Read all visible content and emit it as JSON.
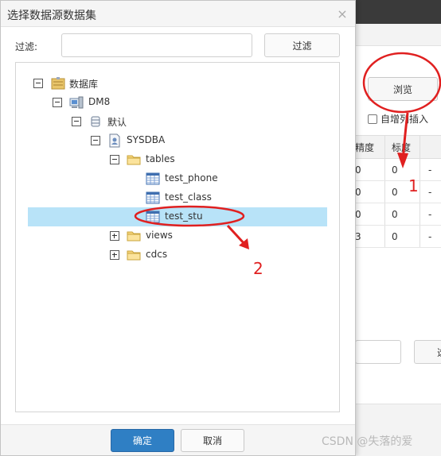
{
  "colors": {
    "accent": "#2f7fc4",
    "selection": "#b8e3f8",
    "annotation": "#e02020"
  },
  "dialog": {
    "title": "选择数据源数据集",
    "close_icon": "×"
  },
  "filter": {
    "label": "过滤:",
    "value": "",
    "placeholder": "",
    "button_label": "过滤"
  },
  "tree": {
    "nodes": [
      {
        "label": "数据库",
        "icon": "database-icon",
        "toggle": "minus"
      },
      {
        "label": "DM8",
        "icon": "server-icon",
        "toggle": "minus"
      },
      {
        "label": "默认",
        "icon": "cylinder-icon",
        "toggle": "minus"
      },
      {
        "label": "SYSDBA",
        "icon": "schema-icon",
        "toggle": "minus"
      },
      {
        "label": "tables",
        "icon": "folder-icon",
        "toggle": "minus"
      },
      {
        "label": "test_phone",
        "icon": "table-icon",
        "toggle": "none"
      },
      {
        "label": "test_class",
        "icon": "table-icon",
        "toggle": "none"
      },
      {
        "label": "test_stu",
        "icon": "table-icon",
        "toggle": "none",
        "selected": true
      },
      {
        "label": "views",
        "icon": "folder-icon",
        "toggle": "plus"
      },
      {
        "label": "cdcs",
        "icon": "folder-icon",
        "toggle": "plus"
      }
    ]
  },
  "footer": {
    "ok_label": "确定",
    "cancel_label": "取消"
  },
  "background": {
    "browse_label": "浏览",
    "auto_increment_label": "自增列插入",
    "table_headers": [
      "精度",
      "标度"
    ],
    "rows": [
      [
        "0",
        "0",
        "-"
      ],
      [
        "0",
        "0",
        "-"
      ],
      [
        "0",
        "0",
        "-"
      ],
      [
        "3",
        "0",
        "-"
      ]
    ],
    "right_button_label": "选"
  },
  "annotations": {
    "label_1": "1",
    "label_2": "2"
  },
  "watermark": "CSDN @失落的爱"
}
